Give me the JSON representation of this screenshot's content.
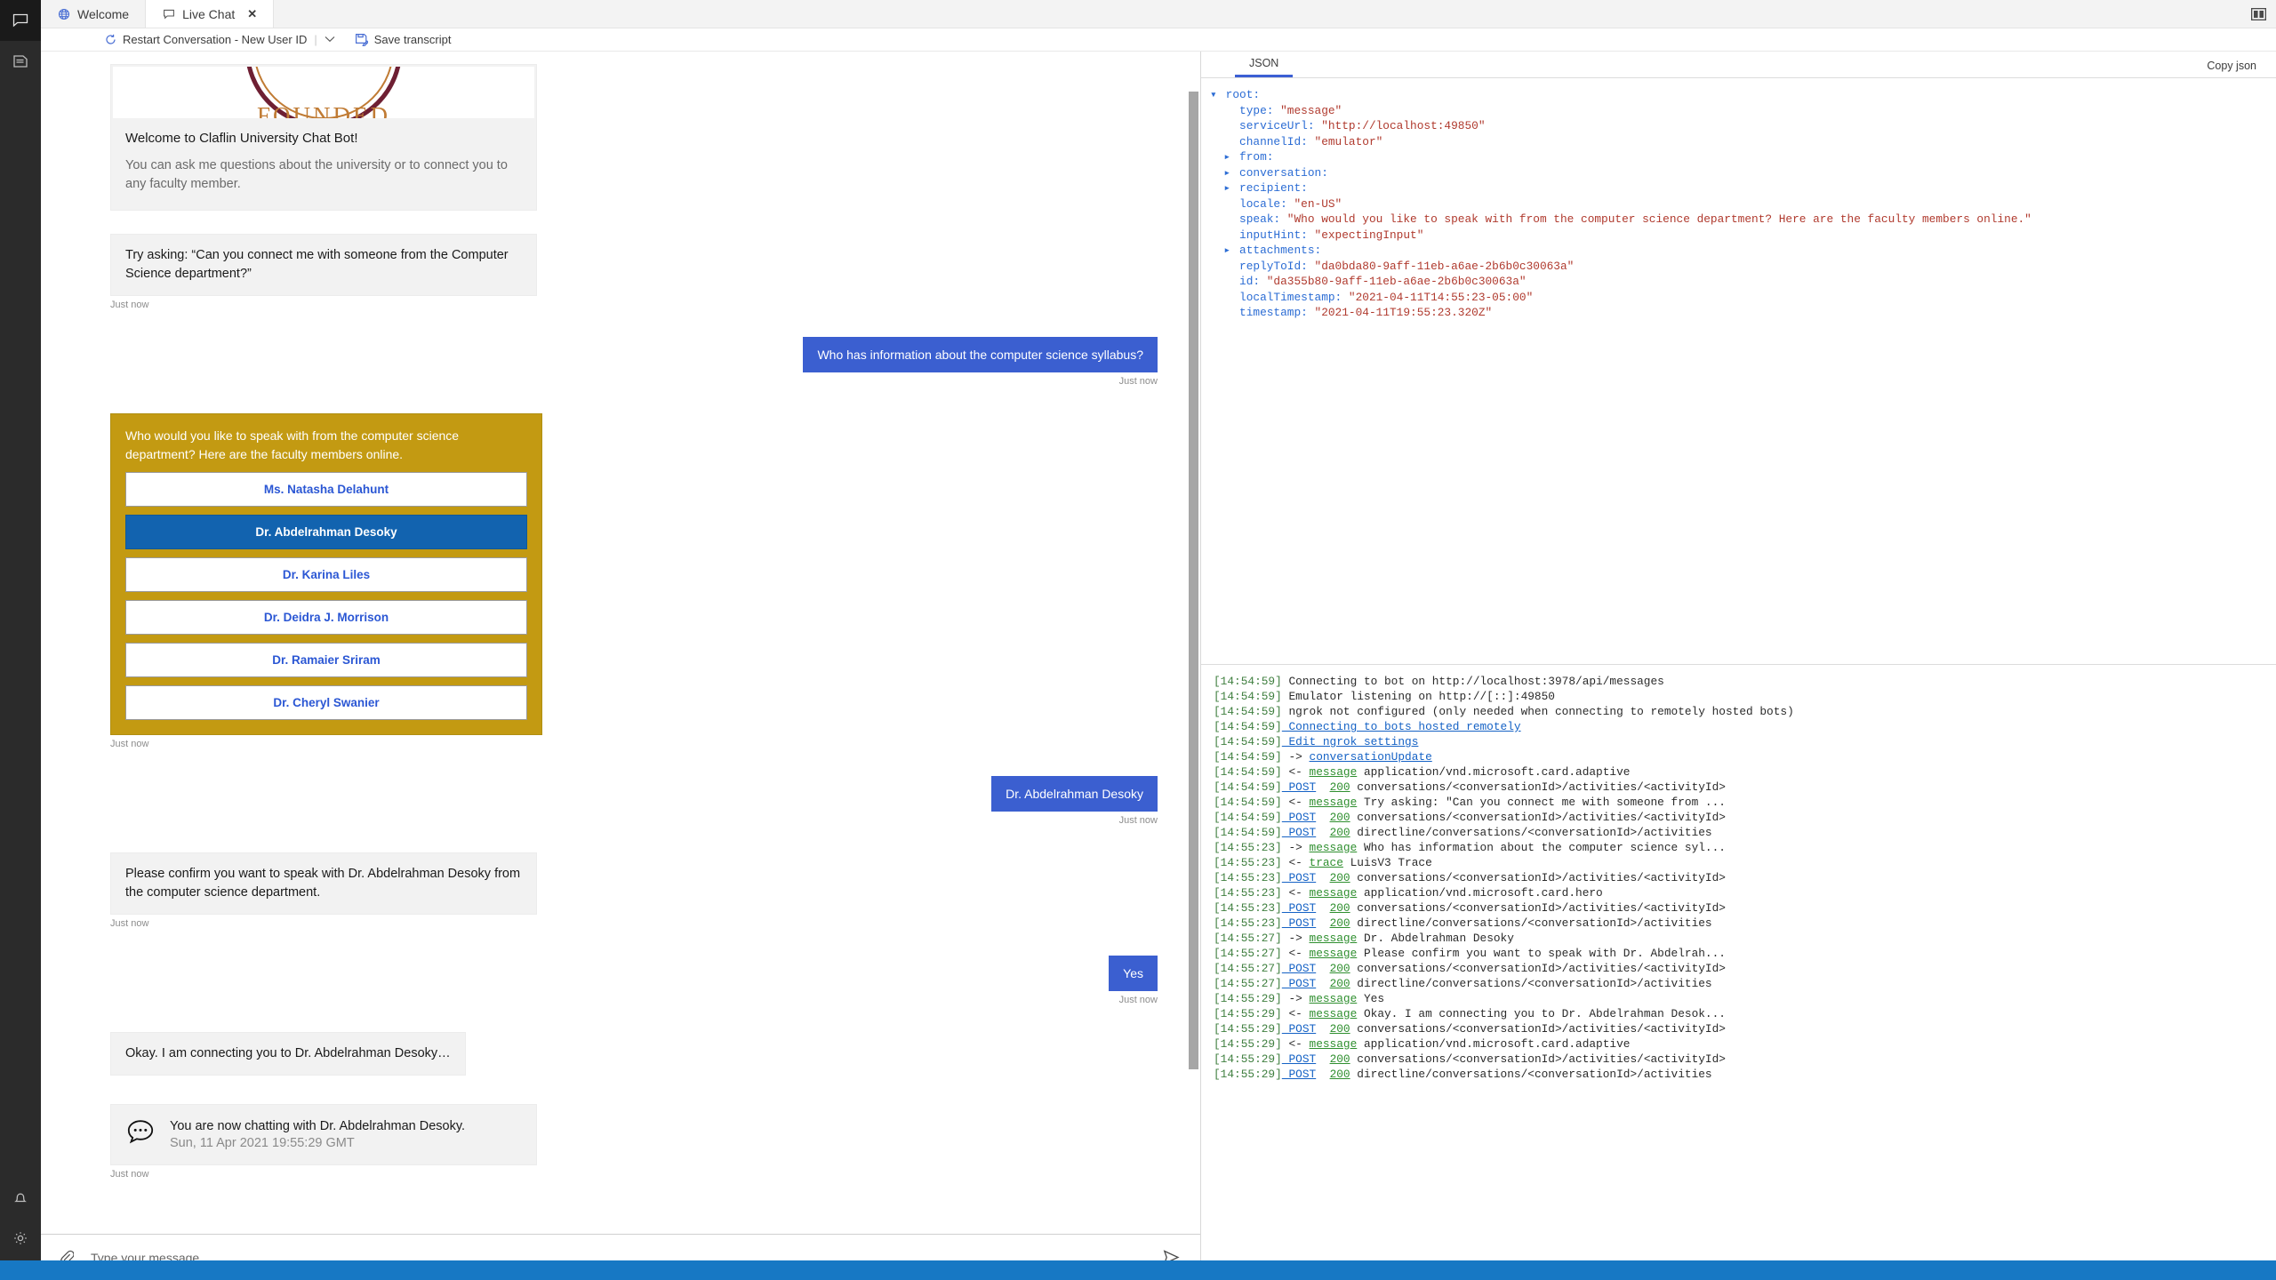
{
  "activity_bar": {
    "items": [
      {
        "icon": "chat-icon",
        "active": true
      },
      {
        "icon": "document-icon",
        "active": false
      },
      {
        "icon": "bell-icon",
        "active": false
      },
      {
        "icon": "gear-icon",
        "active": false
      }
    ]
  },
  "tabs": [
    {
      "label": "Welcome",
      "icon": "globe-icon",
      "active": false,
      "closable": false
    },
    {
      "label": "Live Chat",
      "icon": "chat-bubble-icon",
      "active": true,
      "closable": true,
      "close_label": "✕"
    }
  ],
  "window": {
    "layout_button": "split-layout-icon"
  },
  "toolbar": {
    "restart_label": "Restart Conversation - New User ID",
    "restart_icon": "restart-circle-icon",
    "separator": "|",
    "caret": "⌄",
    "save_transcript_label": "Save transcript",
    "save_transcript_icon": "save-transcript-icon"
  },
  "chat": {
    "welcome_card": {
      "image": "claflin-university-seal",
      "seal_text": "FOUNDED",
      "title": "Welcome to Claflin University Chat Bot!",
      "subtitle": "You can ask me questions about the university or to connect you to any faculty member."
    },
    "try_asking": {
      "text": "Try asking: “Can you connect me with someone from the Computer Science department?”",
      "timestamp": "Just now"
    },
    "user_msg_1": {
      "text": "Who has information about the computer science syllabus?",
      "timestamp": "Just now"
    },
    "faculty_card": {
      "prompt": "Who would you like to speak with from the computer science department? Here are the faculty members online.",
      "background_color": "#c39a12",
      "selected_color": "#1263af",
      "button_text_color": "#2b57d4",
      "timestamp": "Just now",
      "options": [
        {
          "label": "Ms. Natasha Delahunt",
          "selected": false
        },
        {
          "label": "Dr. Abdelrahman Desoky",
          "selected": true
        },
        {
          "label": "Dr. Karina Liles",
          "selected": false
        },
        {
          "label": "Dr. Deidra J. Morrison",
          "selected": false
        },
        {
          "label": "Dr. Ramaier Sriram",
          "selected": false
        },
        {
          "label": "Dr. Cheryl Swanier",
          "selected": false
        }
      ]
    },
    "user_msg_2": {
      "text": "Dr. Abdelrahman Desoky",
      "timestamp": "Just now"
    },
    "confirm_msg": {
      "text": "Please confirm you want to speak with Dr. Abdelrahman Desoky from the computer science department.",
      "timestamp": "Just now"
    },
    "user_msg_3": {
      "text": "Yes",
      "timestamp": "Just now"
    },
    "connecting_msg": {
      "text": "Okay. I am connecting you to Dr. Abdelrahman Desoky…"
    },
    "handoff_card": {
      "icon": "chat-dots-icon",
      "line1": "You are now chatting with Dr. Abdelrahman Desoky.",
      "line2": "Sun, 11 Apr 2021 19:55:29 GMT",
      "timestamp": "Just now"
    },
    "composer": {
      "placeholder": "Type your message",
      "value": "",
      "attach_icon": "paperclip-icon",
      "send_icon": "send-icon"
    },
    "user_bubble_color": "#3b5fd0"
  },
  "inspector": {
    "tabs": [
      {
        "label": "JSON",
        "active": true
      }
    ],
    "copy_label": "Copy json",
    "accent_color": "#3c5fd4",
    "json_lines": [
      {
        "indent": 0,
        "arrow": "▾",
        "key": "root:",
        "value": ""
      },
      {
        "indent": 1,
        "arrow": "",
        "key": "type:",
        "value": " \"message\""
      },
      {
        "indent": 1,
        "arrow": "",
        "key": "serviceUrl:",
        "value": " \"http://localhost:49850\""
      },
      {
        "indent": 1,
        "arrow": "",
        "key": "channelId:",
        "value": " \"emulator\""
      },
      {
        "indent": 1,
        "arrow": "▸",
        "key": "from:",
        "value": ""
      },
      {
        "indent": 1,
        "arrow": "▸",
        "key": "conversation:",
        "value": ""
      },
      {
        "indent": 1,
        "arrow": "▸",
        "key": "recipient:",
        "value": ""
      },
      {
        "indent": 1,
        "arrow": "",
        "key": "locale:",
        "value": " \"en-US\""
      },
      {
        "indent": 1,
        "arrow": "",
        "key": "speak:",
        "value": " \"Who would you like to speak with from the computer science department? Here are the faculty members online.\""
      },
      {
        "indent": 1,
        "arrow": "",
        "key": "inputHint:",
        "value": " \"expectingInput\""
      },
      {
        "indent": 1,
        "arrow": "▸",
        "key": "attachments:",
        "value": ""
      },
      {
        "indent": 1,
        "arrow": "",
        "key": "replyToId:",
        "value": " \"da0bda80-9aff-11eb-a6ae-2b6b0c30063a\""
      },
      {
        "indent": 1,
        "arrow": "",
        "key": "id:",
        "value": " \"da355b80-9aff-11eb-a6ae-2b6b0c30063a\""
      },
      {
        "indent": 1,
        "arrow": "",
        "key": "localTimestamp:",
        "value": " \"2021-04-11T14:55:23-05:00\""
      },
      {
        "indent": 1,
        "arrow": "",
        "key": "timestamp:",
        "value": " \"2021-04-11T19:55:23.320Z\""
      }
    ],
    "log_lines": [
      {
        "ts": "[14:54:59]",
        "parts": [
          {
            "t": "plain",
            "s": " Connecting to bot on http://localhost:3978/api/messages"
          }
        ]
      },
      {
        "ts": "[14:54:59]",
        "parts": [
          {
            "t": "plain",
            "s": " Emulator listening on http://[::]:49850"
          }
        ]
      },
      {
        "ts": "[14:54:59]",
        "parts": [
          {
            "t": "plain",
            "s": " ngrok not configured (only needed when connecting to remotely hosted bots)"
          }
        ]
      },
      {
        "ts": "[14:54:59]",
        "parts": [
          {
            "t": "link",
            "s": " Connecting to bots hosted remotely"
          }
        ]
      },
      {
        "ts": "[14:54:59]",
        "parts": [
          {
            "t": "link",
            "s": " Edit ngrok settings"
          }
        ]
      },
      {
        "ts": "[14:54:59]",
        "parts": [
          {
            "t": "plain",
            "s": " -> "
          },
          {
            "t": "link",
            "s": "conversationUpdate"
          }
        ]
      },
      {
        "ts": "[14:54:59]",
        "parts": [
          {
            "t": "plain",
            "s": " <- "
          },
          {
            "t": "green",
            "s": "message"
          },
          {
            "t": "plain",
            "s": " application/vnd.microsoft.card.adaptive"
          }
        ]
      },
      {
        "ts": "[14:54:59]",
        "parts": [
          {
            "t": "link",
            "s": " POST"
          },
          {
            "t": "plain",
            "s": "  "
          },
          {
            "t": "green",
            "s": "200"
          },
          {
            "t": "plain",
            "s": " conversations/<conversationId>/activities/<activityId>"
          }
        ]
      },
      {
        "ts": "[14:54:59]",
        "parts": [
          {
            "t": "plain",
            "s": " <- "
          },
          {
            "t": "green",
            "s": "message"
          },
          {
            "t": "plain",
            "s": " Try asking: \"Can you connect me with someone from ..."
          }
        ]
      },
      {
        "ts": "[14:54:59]",
        "parts": [
          {
            "t": "link",
            "s": " POST"
          },
          {
            "t": "plain",
            "s": "  "
          },
          {
            "t": "green",
            "s": "200"
          },
          {
            "t": "plain",
            "s": " conversations/<conversationId>/activities/<activityId>"
          }
        ]
      },
      {
        "ts": "[14:54:59]",
        "parts": [
          {
            "t": "link",
            "s": " POST"
          },
          {
            "t": "plain",
            "s": "  "
          },
          {
            "t": "green",
            "s": "200"
          },
          {
            "t": "plain",
            "s": " directline/conversations/<conversationId>/activities"
          }
        ]
      },
      {
        "ts": "[14:55:23]",
        "parts": [
          {
            "t": "plain",
            "s": " -> "
          },
          {
            "t": "green",
            "s": "message"
          },
          {
            "t": "plain",
            "s": " Who has information about the computer science syl..."
          }
        ]
      },
      {
        "ts": "[14:55:23]",
        "parts": [
          {
            "t": "plain",
            "s": " <- "
          },
          {
            "t": "green",
            "s": "trace"
          },
          {
            "t": "plain",
            "s": " LuisV3 Trace"
          }
        ]
      },
      {
        "ts": "[14:55:23]",
        "parts": [
          {
            "t": "link",
            "s": " POST"
          },
          {
            "t": "plain",
            "s": "  "
          },
          {
            "t": "green",
            "s": "200"
          },
          {
            "t": "plain",
            "s": " conversations/<conversationId>/activities/<activityId>"
          }
        ]
      },
      {
        "ts": "[14:55:23]",
        "parts": [
          {
            "t": "plain",
            "s": " <- "
          },
          {
            "t": "green",
            "s": "message"
          },
          {
            "t": "plain",
            "s": " application/vnd.microsoft.card.hero"
          }
        ]
      },
      {
        "ts": "[14:55:23]",
        "parts": [
          {
            "t": "link",
            "s": " POST"
          },
          {
            "t": "plain",
            "s": "  "
          },
          {
            "t": "green",
            "s": "200"
          },
          {
            "t": "plain",
            "s": " conversations/<conversationId>/activities/<activityId>"
          }
        ]
      },
      {
        "ts": "[14:55:23]",
        "parts": [
          {
            "t": "link",
            "s": " POST"
          },
          {
            "t": "plain",
            "s": "  "
          },
          {
            "t": "green",
            "s": "200"
          },
          {
            "t": "plain",
            "s": " directline/conversations/<conversationId>/activities"
          }
        ]
      },
      {
        "ts": "[14:55:27]",
        "parts": [
          {
            "t": "plain",
            "s": " -> "
          },
          {
            "t": "green",
            "s": "message"
          },
          {
            "t": "plain",
            "s": " Dr. Abdelrahman Desoky"
          }
        ]
      },
      {
        "ts": "[14:55:27]",
        "parts": [
          {
            "t": "plain",
            "s": " <- "
          },
          {
            "t": "green",
            "s": "message"
          },
          {
            "t": "plain",
            "s": " Please confirm you want to speak with Dr. Abdelrah..."
          }
        ]
      },
      {
        "ts": "[14:55:27]",
        "parts": [
          {
            "t": "link",
            "s": " POST"
          },
          {
            "t": "plain",
            "s": "  "
          },
          {
            "t": "green",
            "s": "200"
          },
          {
            "t": "plain",
            "s": " conversations/<conversationId>/activities/<activityId>"
          }
        ]
      },
      {
        "ts": "[14:55:27]",
        "parts": [
          {
            "t": "link",
            "s": " POST"
          },
          {
            "t": "plain",
            "s": "  "
          },
          {
            "t": "green",
            "s": "200"
          },
          {
            "t": "plain",
            "s": " directline/conversations/<conversationId>/activities"
          }
        ]
      },
      {
        "ts": "[14:55:29]",
        "parts": [
          {
            "t": "plain",
            "s": " -> "
          },
          {
            "t": "green",
            "s": "message"
          },
          {
            "t": "plain",
            "s": " Yes"
          }
        ]
      },
      {
        "ts": "[14:55:29]",
        "parts": [
          {
            "t": "plain",
            "s": " <- "
          },
          {
            "t": "green",
            "s": "message"
          },
          {
            "t": "plain",
            "s": " Okay. I am connecting you to Dr. Abdelrahman Desok..."
          }
        ]
      },
      {
        "ts": "[14:55:29]",
        "parts": [
          {
            "t": "link",
            "s": " POST"
          },
          {
            "t": "plain",
            "s": "  "
          },
          {
            "t": "green",
            "s": "200"
          },
          {
            "t": "plain",
            "s": " conversations/<conversationId>/activities/<activityId>"
          }
        ]
      },
      {
        "ts": "[14:55:29]",
        "parts": [
          {
            "t": "plain",
            "s": " <- "
          },
          {
            "t": "green",
            "s": "message"
          },
          {
            "t": "plain",
            "s": " application/vnd.microsoft.card.adaptive"
          }
        ]
      },
      {
        "ts": "[14:55:29]",
        "parts": [
          {
            "t": "link",
            "s": " POST"
          },
          {
            "t": "plain",
            "s": "  "
          },
          {
            "t": "green",
            "s": "200"
          },
          {
            "t": "plain",
            "s": " conversations/<conversationId>/activities/<activityId>"
          }
        ]
      },
      {
        "ts": "[14:55:29]",
        "parts": [
          {
            "t": "link",
            "s": " POST"
          },
          {
            "t": "plain",
            "s": "  "
          },
          {
            "t": "green",
            "s": "200"
          },
          {
            "t": "plain",
            "s": " directline/conversations/<conversationId>/activities"
          }
        ]
      }
    ]
  },
  "statusbar": {
    "color": "#1778c4"
  }
}
